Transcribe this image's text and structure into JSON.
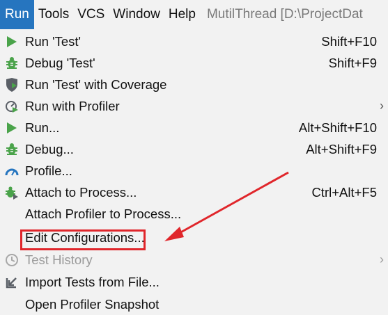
{
  "menubar": {
    "items": [
      {
        "label": "Run",
        "active": true
      },
      {
        "label": "Tools"
      },
      {
        "label": "VCS"
      },
      {
        "label": "Window"
      },
      {
        "label": "Help"
      }
    ],
    "window_title": "MutilThread [D:\\ProjectDat"
  },
  "menu": {
    "items": [
      {
        "label": "Run 'Test'",
        "shortcut": "Shift+F10",
        "icon": "run-icon"
      },
      {
        "label": "Debug 'Test'",
        "shortcut": "Shift+F9",
        "icon": "debug-icon"
      },
      {
        "label": "Run 'Test' with Coverage",
        "shortcut": "",
        "icon": "coverage-icon"
      },
      {
        "label": "Run with Profiler",
        "shortcut": "",
        "icon": "profiler-icon",
        "submenu": "›"
      },
      {
        "label": "Run...",
        "shortcut": "Alt+Shift+F10",
        "icon": "run-icon"
      },
      {
        "label": "Debug...",
        "shortcut": "Alt+Shift+F9",
        "icon": "debug-icon"
      },
      {
        "label": "Profile...",
        "shortcut": "",
        "icon": "profile-gauge-icon"
      },
      {
        "label": "Attach to Process...",
        "shortcut": "Ctrl+Alt+F5",
        "icon": "attach-debugger-icon"
      },
      {
        "label": "Attach Profiler to Process...",
        "shortcut": "",
        "icon": ""
      },
      {
        "label": "Edit Configurations...",
        "shortcut": "",
        "icon": "",
        "highlighted": true
      },
      {
        "label": "Test History",
        "shortcut": "",
        "icon": "history-icon",
        "disabled": true,
        "submenu": "›"
      },
      {
        "label": "Import Tests from File...",
        "shortcut": "",
        "icon": "import-icon"
      },
      {
        "label": "Open Profiler Snapshot",
        "shortcut": "",
        "icon": ""
      }
    ]
  },
  "colors": {
    "accent": "#2675bf",
    "run_green": "#4aa34a",
    "annotation_red": "#e0262b",
    "background": "#f2f2f2"
  }
}
